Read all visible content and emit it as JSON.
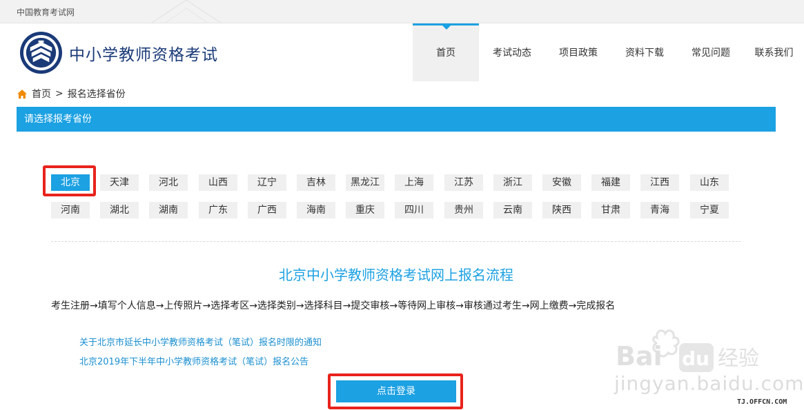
{
  "topbar": {
    "site_name": "中国教育考试网"
  },
  "header": {
    "brand": "中小学教师资格考试",
    "nav": [
      {
        "label": "首页",
        "active": true
      },
      {
        "label": "考试动态",
        "active": false
      },
      {
        "label": "项目政策",
        "active": false
      },
      {
        "label": "资料下载",
        "active": false
      },
      {
        "label": "常见问题",
        "active": false
      },
      {
        "label": "联系我们",
        "active": false
      }
    ]
  },
  "breadcrumb": {
    "home": "首页",
    "separator": ">",
    "current": "报名选择省份"
  },
  "section": {
    "title": "请选择报考省份"
  },
  "provinces": {
    "selected": "北京",
    "row1": [
      "北京",
      "天津",
      "河北",
      "山西",
      "辽宁",
      "吉林",
      "黑龙江",
      "上海",
      "江苏",
      "浙江",
      "安徽",
      "福建",
      "江西",
      "山东"
    ],
    "row2": [
      "河南",
      "湖北",
      "湖南",
      "广东",
      "广西",
      "海南",
      "重庆",
      "四川",
      "贵州",
      "云南",
      "陕西",
      "甘肃",
      "青海",
      "宁夏"
    ]
  },
  "flow": {
    "title": "北京中小学教师资格考试网上报名流程",
    "steps": "考生注册→填写个人信息→上传照片→选择考区→选择类别→选择科目→提交审核→等待网上审核→审核通过考生→网上缴费→完成报名"
  },
  "notices": [
    "关于北京市延长中小学教师资格考试（笔试）报名时限的通知",
    "北京2019年下半年中小学教师资格考试（笔试）报名公告"
  ],
  "login": {
    "label": "点击登录"
  },
  "watermark": {
    "text": "jingyan.baidu.com",
    "source": "TJ.OFFCN.COM"
  },
  "colors": {
    "accent": "#1ca1e2",
    "brand": "#1a3a78",
    "highlight": "#e8231c"
  }
}
